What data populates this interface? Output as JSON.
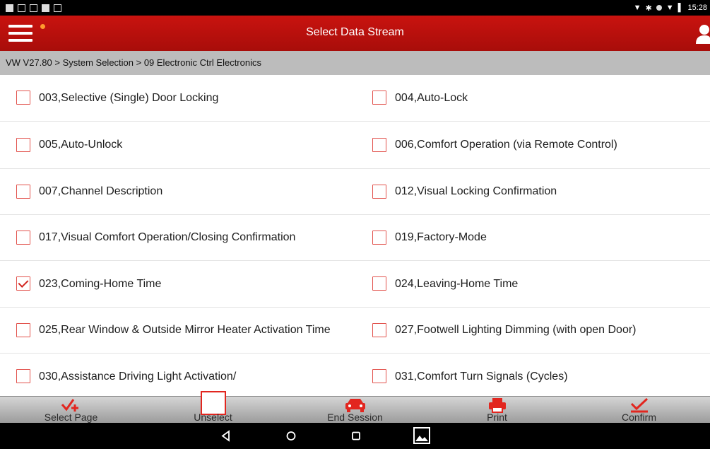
{
  "status": {
    "time": "15:28"
  },
  "header": {
    "title": "Select Data Stream"
  },
  "breadcrumb": "VW V27.80 > System Selection > 09 Electronic Ctrl Electronics",
  "items": [
    {
      "label": "003,Selective (Single) Door Locking",
      "checked": false
    },
    {
      "label": "004,Auto-Lock",
      "checked": false
    },
    {
      "label": "005,Auto-Unlock",
      "checked": false
    },
    {
      "label": "006,Comfort Operation (via Remote Control)",
      "checked": false
    },
    {
      "label": "007,Channel Description",
      "checked": false
    },
    {
      "label": "012,Visual Locking Confirmation",
      "checked": false
    },
    {
      "label": "017,Visual Comfort Operation/Closing Confirmation",
      "checked": false
    },
    {
      "label": "019,Factory-Mode",
      "checked": false
    },
    {
      "label": "023,Coming-Home Time",
      "checked": true
    },
    {
      "label": "024,Leaving-Home Time",
      "checked": false
    },
    {
      "label": "025,Rear Window & Outside Mirror Heater Activation Time",
      "checked": false
    },
    {
      "label": "027,Footwell Lighting Dimming (with open Door)",
      "checked": false
    },
    {
      "label": "030,Assistance Driving Light Activation/",
      "checked": false
    },
    {
      "label": "031,Comfort Turn Signals (Cycles)",
      "checked": false
    }
  ],
  "toolbar": {
    "select_page": "Select Page",
    "unselect": "Unselect",
    "end_session": "End Session",
    "print": "Print",
    "confirm": "Confirm"
  },
  "colors": {
    "accent": "#c9130f",
    "checkbox": "#e2534d"
  }
}
